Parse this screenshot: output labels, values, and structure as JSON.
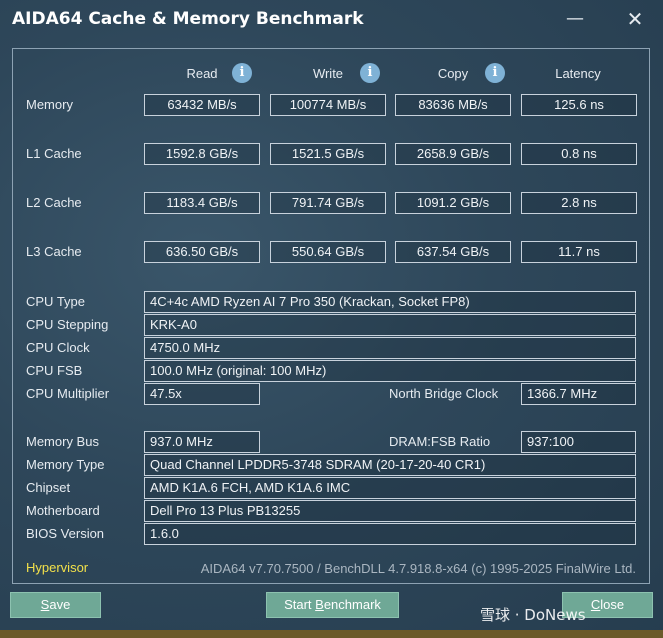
{
  "window": {
    "title": "AIDA64 Cache & Memory Benchmark",
    "minimize_glyph": "—",
    "close_glyph": "✕"
  },
  "columns": {
    "read": "Read",
    "write": "Write",
    "copy": "Copy",
    "latency": "Latency",
    "info_glyph": "i"
  },
  "rows": {
    "memory": {
      "label": "Memory",
      "read": "63432 MB/s",
      "write": "100774 MB/s",
      "copy": "83636 MB/s",
      "latency": "125.6 ns"
    },
    "l1": {
      "label": "L1 Cache",
      "read": "1592.8 GB/s",
      "write": "1521.5 GB/s",
      "copy": "2658.9 GB/s",
      "latency": "0.8 ns"
    },
    "l2": {
      "label": "L2 Cache",
      "read": "1183.4 GB/s",
      "write": "791.74 GB/s",
      "copy": "1091.2 GB/s",
      "latency": "2.8 ns"
    },
    "l3": {
      "label": "L3 Cache",
      "read": "636.50 GB/s",
      "write": "550.64 GB/s",
      "copy": "637.54 GB/s",
      "latency": "11.7 ns"
    }
  },
  "cpu": {
    "type_label": "CPU Type",
    "type_value": "4C+4c AMD Ryzen AI 7 Pro 350  (Krackan, Socket FP8)",
    "stepping_label": "CPU Stepping",
    "stepping_value": "KRK-A0",
    "clock_label": "CPU Clock",
    "clock_value": "4750.0 MHz",
    "fsb_label": "CPU FSB",
    "fsb_value": "100.0 MHz  (original: 100 MHz)",
    "multiplier_label": "CPU Multiplier",
    "multiplier_value": "47.5x",
    "nb_clock_label": "North Bridge Clock",
    "nb_clock_value": "1366.7 MHz"
  },
  "memory_info": {
    "bus_label": "Memory Bus",
    "bus_value": "937.0 MHz",
    "ratio_label": "DRAM:FSB Ratio",
    "ratio_value": "937:100",
    "type_label": "Memory Type",
    "type_value": "Quad Channel LPDDR5-3748 SDRAM  (20-17-20-40 CR1)",
    "chipset_label": "Chipset",
    "chipset_value": "AMD K1A.6 FCH, AMD K1A.6 IMC",
    "motherboard_label": "Motherboard",
    "motherboard_value": "Dell Pro 13 Plus PB13255",
    "bios_label": "BIOS Version",
    "bios_value": "1.6.0"
  },
  "footer": {
    "hypervisor": "Hypervisor",
    "version": "AIDA64 v7.70.7500 / BenchDLL 4.7.918.8-x64  (c) 1995-2025 FinalWire Ltd."
  },
  "buttons": {
    "save_first": "S",
    "save_rest": "ave",
    "start_pre": "Start ",
    "start_ul": "B",
    "start_post": "enchmark",
    "close_first": "C",
    "close_rest": "lose"
  },
  "watermark": "雪球 · DoNews",
  "colors": {
    "background": "#2e475a",
    "button": "#6fa896",
    "hypervisor": "#f2e04a",
    "info_icon": "#7fb2d6"
  }
}
